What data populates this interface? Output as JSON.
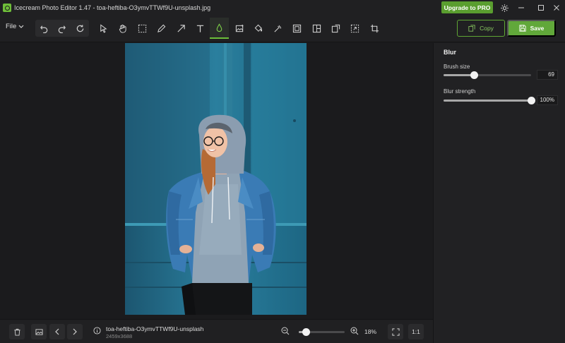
{
  "window": {
    "title": "Icecream Photo Editor 1.47 - toa-heftiba-O3ymvTTWf9U-unsplash.jpg",
    "upgrade_label": "Upgrade to PRO"
  },
  "toolbar": {
    "file_label": "File",
    "tools": [
      "select-tool",
      "hand-tool",
      "marquee-tool",
      "pencil-tool",
      "arrow-tool",
      "text-tool",
      "blur-tool",
      "image-tool",
      "fill-tool",
      "magic-wand-tool",
      "frame-tool",
      "collage-tool",
      "export-tool",
      "transform-tool",
      "crop-tool"
    ],
    "active_tool": "blur-tool",
    "copy_label": "Copy",
    "save_label": "Save"
  },
  "panel": {
    "title": "Blur",
    "brush_size": {
      "label": "Brush size",
      "value": "69",
      "fraction": 0.35
    },
    "blur_strength": {
      "label": "Blur strength",
      "value": "100%",
      "fraction": 1.0
    }
  },
  "status": {
    "file_name": "toa-heftiba-O3ymvTTWf9U-unsplash",
    "file_dims": "2459x3688",
    "zoom_value": "18%",
    "zoom_fraction": 0.15,
    "ratio_label": "1:1"
  },
  "colors": {
    "accent": "#61a83a",
    "background": "#1b1b1d",
    "panel": "#212123"
  }
}
